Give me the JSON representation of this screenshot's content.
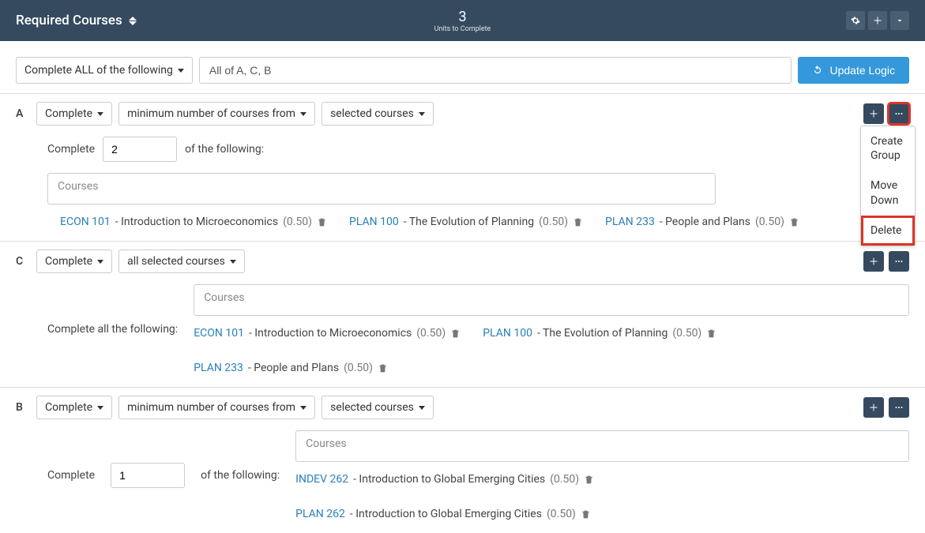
{
  "header": {
    "title": "Required Courses",
    "units_number": "3",
    "units_label": "Units to Complete"
  },
  "logic": {
    "rule_select": "Complete ALL of the following",
    "summary": "All of A, C, B",
    "update_button": "Update Logic"
  },
  "groups": [
    {
      "label": "A",
      "complete_select": "Complete",
      "qty_select": "minimum number of courses from",
      "scope_select": "selected courses",
      "complete_prefix": "Complete",
      "qty_value": "2",
      "complete_suffix": "of the following:",
      "courses_placeholder": "Courses",
      "layout": "stacked",
      "courses": [
        {
          "code": "ECON 101",
          "sep": " - ",
          "name": "Introduction to Microeconomics",
          "units": "(0.50)"
        },
        {
          "code": "PLAN 100",
          "sep": " - ",
          "name": "The Evolution of Planning",
          "units": "(0.50)"
        },
        {
          "code": "PLAN 233",
          "sep": " - ",
          "name": "People and Plans",
          "units": "(0.50)"
        }
      ],
      "menu_open": true,
      "menu_highlight": true,
      "menu": {
        "create_group": "Create Group",
        "move_down": "Move Down",
        "delete": "Delete"
      }
    },
    {
      "label": "C",
      "complete_select": "Complete",
      "qty_select": "all selected courses",
      "scope_select": "",
      "complete_prefix": "Complete all the following:",
      "qty_value": "",
      "complete_suffix": "",
      "courses_placeholder": "Courses",
      "layout": "inline",
      "courses": [
        {
          "code": "ECON 101",
          "sep": " - ",
          "name": "Introduction to Microeconomics",
          "units": "(0.50)"
        },
        {
          "code": "PLAN 100",
          "sep": " - ",
          "name": "The Evolution of Planning",
          "units": "(0.50)"
        },
        {
          "code": "PLAN 233",
          "sep": " - ",
          "name": "People and Plans",
          "units": "(0.50)"
        }
      ],
      "menu_open": false
    },
    {
      "label": "B",
      "complete_select": "Complete",
      "qty_select": "minimum number of courses from",
      "scope_select": "selected courses",
      "complete_prefix": "Complete",
      "qty_value": "1",
      "complete_suffix": "of the following:",
      "courses_placeholder": "Courses",
      "layout": "inline-qty",
      "courses": [
        {
          "code": "INDEV 262",
          "sep": " - ",
          "name": "Introduction to Global Emerging Cities",
          "units": "(0.50)"
        },
        {
          "code": "PLAN 262",
          "sep": " - ",
          "name": "Introduction to Global Emerging Cities",
          "units": "(0.50)"
        }
      ],
      "menu_open": false
    }
  ]
}
